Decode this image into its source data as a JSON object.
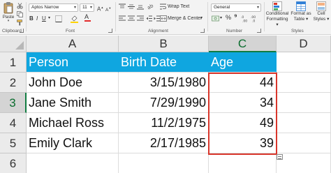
{
  "ribbon": {
    "clipboard": {
      "paste_label": "Paste",
      "group_label": "Clipboard"
    },
    "font": {
      "family": "Aptos Narrow",
      "size": "11",
      "group_label": "Font"
    },
    "alignment": {
      "wrap_text": "Wrap Text",
      "merge_center": "Merge & Center",
      "group_label": "Alignment"
    },
    "number": {
      "format": "General",
      "group_label": "Number"
    },
    "styles": {
      "conditional": [
        "Conditional",
        "Formatting"
      ],
      "format_as_table": [
        "Format as",
        "Table"
      ],
      "cell_styles": [
        "Cell",
        "Styles"
      ],
      "group_label": "Styles"
    }
  },
  "sheet": {
    "corner_icon": "select-all-triangle",
    "columns": [
      "A",
      "B",
      "C",
      "D"
    ],
    "selected_column": "C",
    "rows": [
      "1",
      "2",
      "3",
      "4",
      "5",
      "6"
    ],
    "selected_row": "3",
    "header": {
      "person": "Person",
      "birth": "Birth Date",
      "age": "Age"
    },
    "data": [
      {
        "person": "John Doe",
        "birth": "3/15/1980",
        "age": "44"
      },
      {
        "person": "Jane Smith",
        "birth": "7/29/1990",
        "age": "34"
      },
      {
        "person": "Michael Ross",
        "birth": "11/2/1975",
        "age": "49"
      },
      {
        "person": "Emily Clark",
        "birth": "2/17/1985",
        "age": "39"
      }
    ]
  },
  "colors": {
    "header_fill": "#0fa6e0",
    "selection_border": "#d9362b",
    "excel_green": "#107c41"
  },
  "icons": [
    "paste-icon",
    "bold-icon",
    "italic-icon",
    "underline-icon",
    "wrap-text-icon",
    "merge-center-icon",
    "align-left-icon",
    "align-center-icon",
    "align-right-icon",
    "currency-icon",
    "percent-icon",
    "comma-icon",
    "conditional-formatting-icon",
    "format-as-table-icon",
    "cell-styles-icon",
    "quick-analysis-icon"
  ]
}
